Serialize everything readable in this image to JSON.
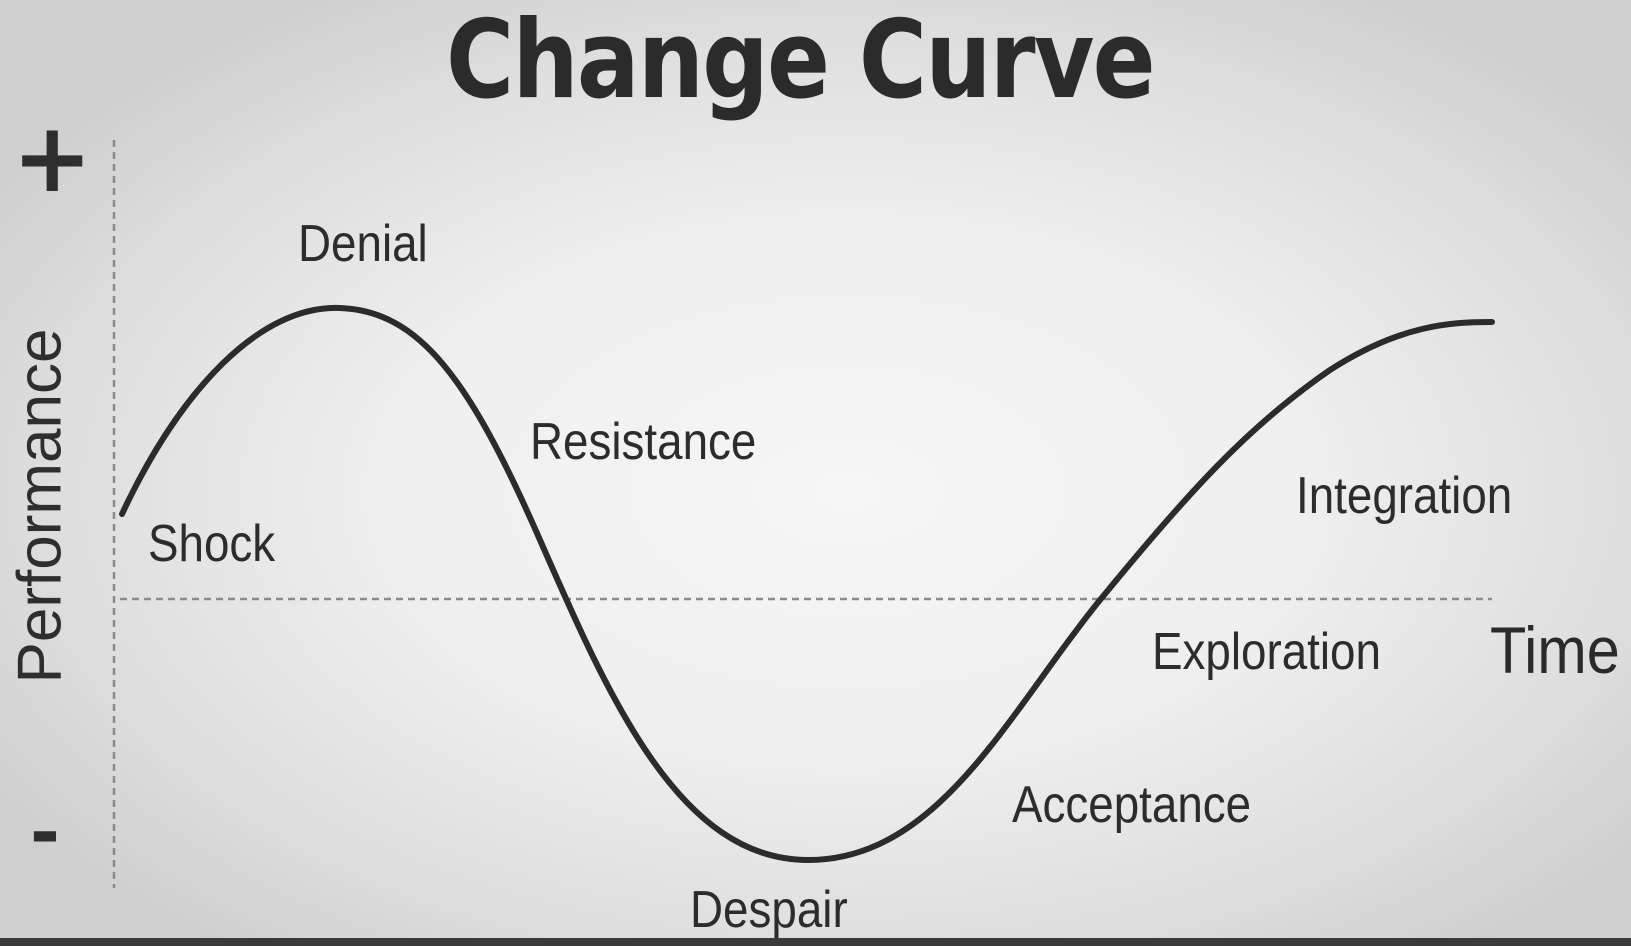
{
  "title": "Change Curve",
  "axes": {
    "y_label": "Performance",
    "y_top_sign": "+",
    "y_bottom_sign": "-",
    "x_label": "Time"
  },
  "stages": [
    {
      "id": "shock",
      "label": "Shock"
    },
    {
      "id": "denial",
      "label": "Denial"
    },
    {
      "id": "resistance",
      "label": "Resistance"
    },
    {
      "id": "despair",
      "label": "Despair"
    },
    {
      "id": "acceptance",
      "label": "Acceptance"
    },
    {
      "id": "exploration",
      "label": "Exploration"
    },
    {
      "id": "integration",
      "label": "Integration"
    }
  ],
  "colors": {
    "curve": "#2b2b2b",
    "axis_dashed": "#8a8a8a",
    "text": "#2a2a2a"
  }
}
